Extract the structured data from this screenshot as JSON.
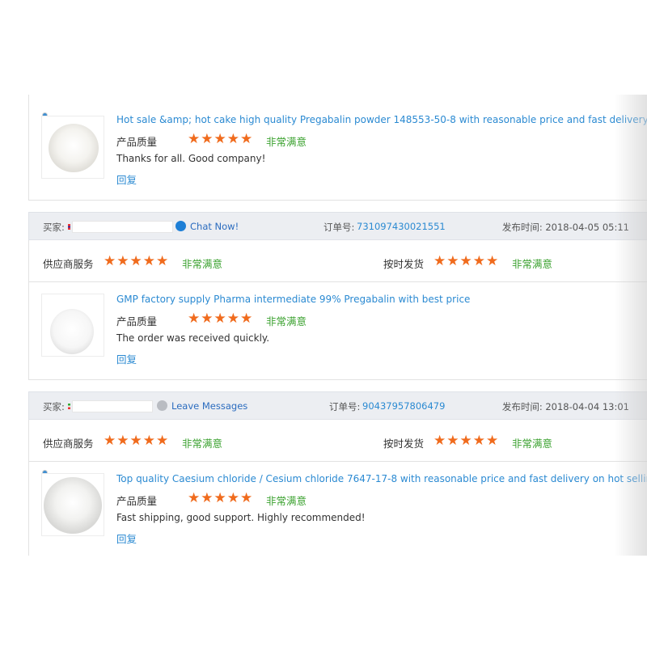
{
  "labels": {
    "buyer": "买家:",
    "order_no": "订单号:",
    "publish_time": "发布时间:",
    "supplier_service": "供应商服务",
    "on_time_delivery": "按时发货",
    "product_quality": "产品质量",
    "very_satisfied": "非常满意",
    "reply": "回复",
    "star_glyph": "★"
  },
  "reviews": [
    {
      "product_title": "Hot sale &amp; hot cake high quality Pregabalin powder 148553-50-8 with reasonable price and fast delivery !!",
      "quality_rating": 5,
      "comment": "Thanks for all. Good company!"
    },
    {
      "buyer_action": "Chat Now!",
      "buyer_action_icon": "chat-bubble-icon",
      "order_number": "731097430021551",
      "publish_date": "2018-04-05 05:11",
      "supplier_service_rating": 5,
      "on_time_rating": 5,
      "product_title": "GMP factory supply Pharma intermediate 99% Pregabalin with best price",
      "quality_rating": 5,
      "comment": "The order was received quickly."
    },
    {
      "buyer_action": "Leave Messages",
      "buyer_action_icon": "message-bubble-icon",
      "order_number": "90437957806479",
      "publish_date": "2018-04-04 13:01",
      "supplier_service_rating": 5,
      "on_time_rating": 5,
      "product_title": "Top quality Caesium chloride / Cesium chloride 7647-17-8 with reasonable price and fast delivery on hot selling !!",
      "quality_rating": 5,
      "comment": "Fast shipping, good support. Highly recommended!"
    }
  ],
  "colors": {
    "link": "#2b8ad2",
    "star": "#f06b1d",
    "satisfied": "#3aa12e",
    "bar_bg": "#eceef2"
  }
}
